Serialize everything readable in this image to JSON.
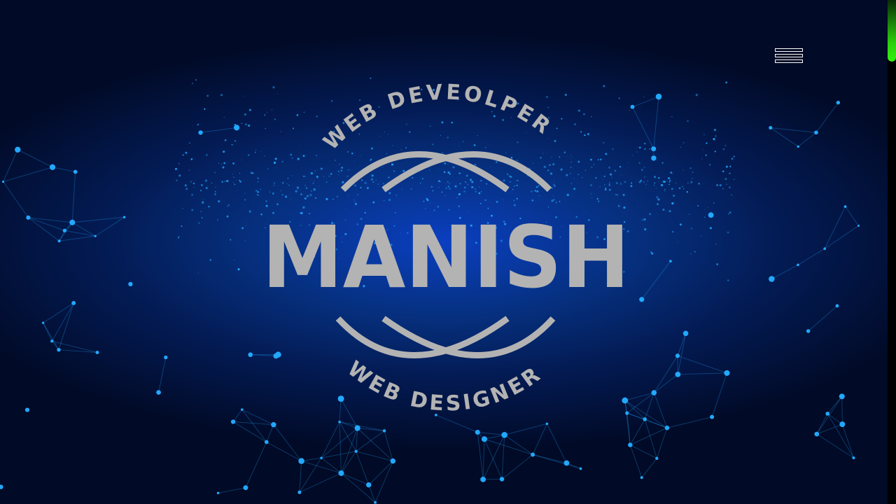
{
  "logo": {
    "name": "MANISH",
    "top_arc_text": "WEB DEVEOLPER",
    "bottom_arc_text": "WEB DESIGNER",
    "color": "#b3b3b3"
  },
  "header": {
    "menu_icon": "hamburger-icon"
  },
  "scrollbar": {
    "thumb_color": "#2bd00c",
    "scroll_position_percent": 0
  },
  "colors": {
    "background": "#06307f",
    "particles": "#22a8ff"
  }
}
